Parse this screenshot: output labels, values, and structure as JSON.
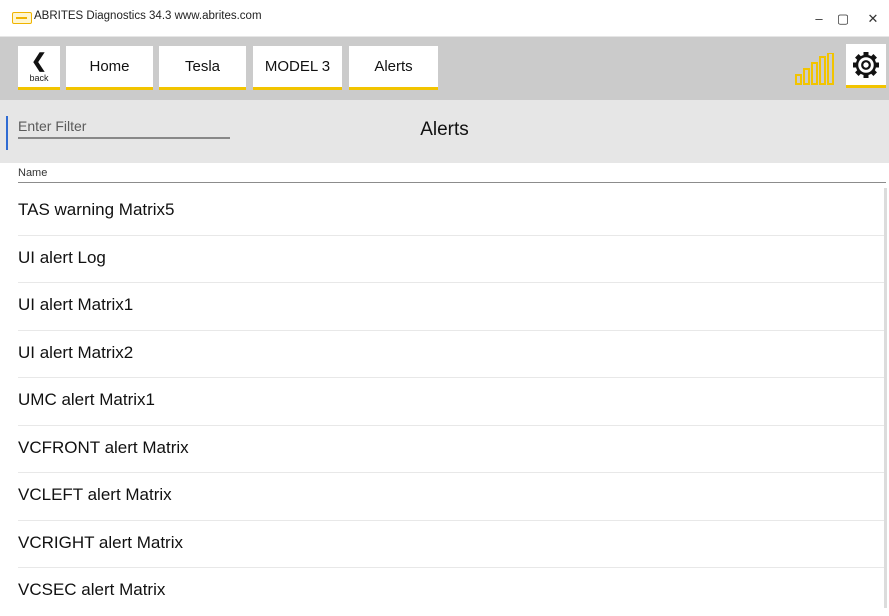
{
  "window": {
    "title": "ABRITES Diagnostics 34.3   www.abrites.com",
    "controls": [
      "–",
      "▢",
      "✕"
    ]
  },
  "toolbar": {
    "back_label": "back",
    "back_icon": "chevron-left-icon",
    "breadcrumbs": [
      "Home",
      "Tesla",
      "MODEL 3",
      "Alerts"
    ],
    "signal_icon": "signal-strength-icon",
    "settings_icon": "gear-icon",
    "accent_color": "#f2c400"
  },
  "filter": {
    "placeholder": "Enter Filter",
    "value": ""
  },
  "page_title": "Alerts",
  "table": {
    "column_header": "Name",
    "rows": [
      "TAS warning Matrix5",
      "UI alert Log",
      "UI alert Matrix1",
      "UI alert Matrix2",
      "UMC alert Matrix1",
      "VCFRONT alert Matrix",
      "VCLEFT alert Matrix",
      "VCRIGHT alert Matrix",
      "VCSEC alert Matrix"
    ]
  }
}
